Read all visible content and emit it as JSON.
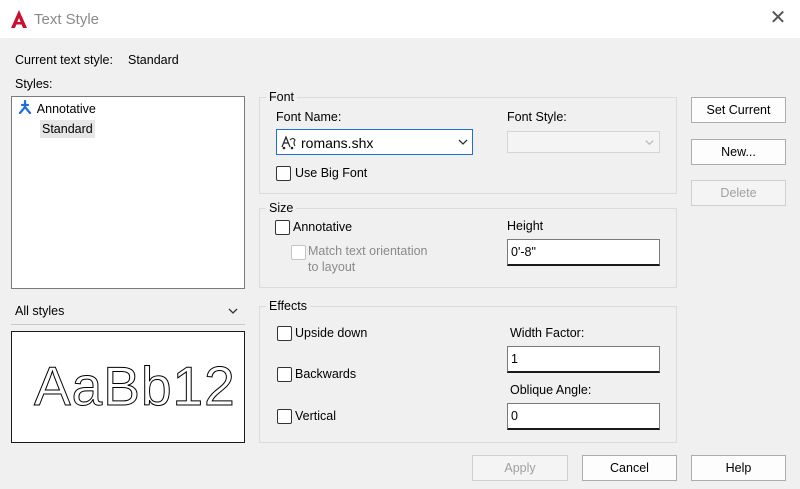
{
  "window": {
    "title": "Text Style",
    "app_icon": "autocad-a-icon",
    "close_glyph": "✕"
  },
  "current_style": {
    "label": "Current text style:",
    "value": "Standard"
  },
  "styles": {
    "label": "Styles:",
    "items": [
      {
        "label": "Annotative",
        "icon": "annotative-icon",
        "selected": false
      },
      {
        "label": "Standard",
        "icon": "",
        "selected": true
      }
    ],
    "filter_value": "All styles",
    "preview_text": "AaBb12"
  },
  "font": {
    "group_label": "Font",
    "name_label": "Font Name:",
    "name_value": "romans.shx",
    "style_label": "Font Style:",
    "style_value": "",
    "big_font_label": "Use Big Font"
  },
  "size": {
    "group_label": "Size",
    "annotative_label": "Annotative",
    "match_label_1": "Match text orientation",
    "match_label_2": "to layout",
    "height_label": "Height",
    "height_value": "0'-8\""
  },
  "effects": {
    "group_label": "Effects",
    "upside_down_label": "Upside down",
    "backwards_label": "Backwards",
    "vertical_label": "Vertical",
    "width_factor_label": "Width Factor:",
    "width_factor_value": "1",
    "oblique_label": "Oblique Angle:",
    "oblique_value": "0"
  },
  "buttons": {
    "set_current": "Set Current",
    "new": "New...",
    "delete": "Delete",
    "apply": "Apply",
    "cancel": "Cancel",
    "help": "Help"
  },
  "colors": {
    "accent": "#1e6fd9",
    "autocad_red": "#c8102e"
  }
}
